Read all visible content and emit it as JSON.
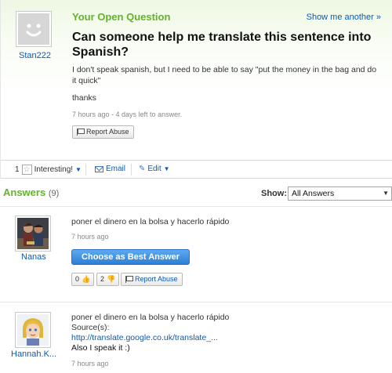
{
  "question": {
    "asker": "Stan222",
    "heading": "Your Open Question",
    "show_another": "Show me another »",
    "title": "Can someone help me translate this sentence into Spanish?",
    "body": "I don't speak spanish, but I need to be able to say \"put the money in the bag and do it quick\"",
    "thanks": "thanks",
    "meta": "7 hours ago - 4 days left to answer.",
    "report_label": "Report Abuse"
  },
  "actions": {
    "interesting_count": "1",
    "interesting_label": "Interesting!",
    "email_label": "Email",
    "edit_label": "Edit"
  },
  "answers_section": {
    "heading": "Answers",
    "count": "(9)",
    "show_label": "Show:",
    "show_value": "All Answers"
  },
  "answers": [
    {
      "author": "Nanas",
      "text": "poner el dinero en la bolsa y hacerlo rápido",
      "meta": "7 hours ago",
      "best_label": "Choose as Best Answer",
      "thumbs_up": "0",
      "thumbs_down": "2",
      "report_label": "Report Abuse"
    },
    {
      "author": "Hannah.K...",
      "text": "poner el dinero en la bolsa y hacerlo rápido",
      "source_label": "Source(s):",
      "source_link": "http://translate.google.co.uk/translate_...",
      "extra": "Also I speak it :)",
      "meta": "7 hours ago"
    }
  ],
  "colors": {
    "accent_green": "#63b32a",
    "link_blue": "#0b59b3",
    "button_blue": "#2b7fd4"
  }
}
